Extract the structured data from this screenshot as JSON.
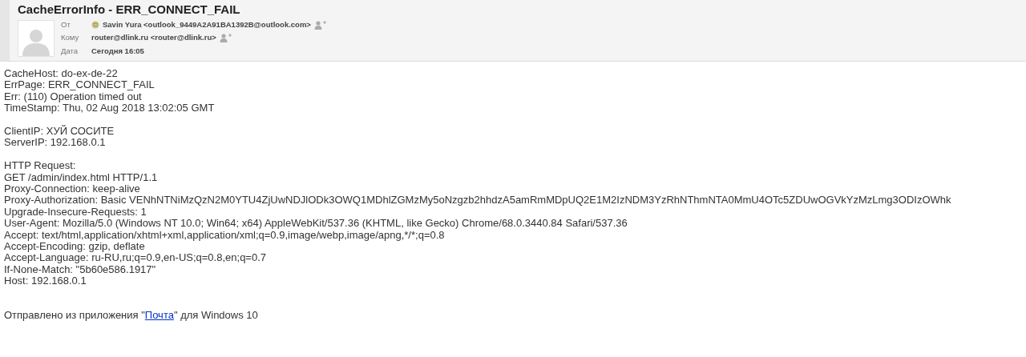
{
  "message": {
    "subject": "CacheErrorInfo - ERR_CONNECT_FAIL",
    "fields": [
      {
        "label": "От",
        "value": "Savin Yura <outlook_9449A2A91BA1392B@outlook.com>",
        "kind": "from"
      },
      {
        "label": "Кому",
        "value": "router@dlink.ru <router@dlink.ru>",
        "kind": "to"
      },
      {
        "label": "Дата",
        "value": "Сегодня 16:05",
        "kind": "date"
      }
    ]
  },
  "body": {
    "paragraphs": [
      [
        "CacheHost: do-ex-de-22",
        "ErrPage: ERR_CONNECT_FAIL",
        "Err: (110) Operation timed out",
        "TimeStamp: Thu, 02 Aug 2018 13:02:05 GMT"
      ],
      [
        "ClientIP: ХУЙ СОСИТЕ",
        "ServerIP: 192.168.0.1"
      ],
      [
        "HTTP Request:",
        "GET /admin/index.html HTTP/1.1",
        "Proxy-Connection: keep-alive",
        "Proxy-Authorization: Basic VENhNTNiMzQzN2M0YTU4ZjUwNDJlODk3OWQ1MDhlZGMzMy5oNzgzb2hhdzA5amRmMDpUQ2E1M2IzNDM3YzRhNThmNTA0MmU4OTc5ZDUwOGVkYzMzLmg3ODIzOWhk",
        "Upgrade-Insecure-Requests: 1",
        "User-Agent: Mozilla/5.0 (Windows NT 10.0; Win64; x64) AppleWebKit/537.36 (KHTML, like Gecko) Chrome/68.0.3440.84 Safari/537.36",
        "Accept: text/html,application/xhtml+xml,application/xml;q=0.9,image/webp,image/apng,*/*;q=0.8",
        "Accept-Encoding: gzip, deflate",
        "Accept-Language: ru-RU,ru;q=0.9,en-US;q=0.8,en;q=0.7",
        "If-None-Match: \"5b60e586.1917\"",
        "Host: 192.168.0.1"
      ]
    ],
    "signature": {
      "before": "Отправлено из приложения \"",
      "link": "Почта",
      "after": "\" для Windows 10"
    }
  }
}
